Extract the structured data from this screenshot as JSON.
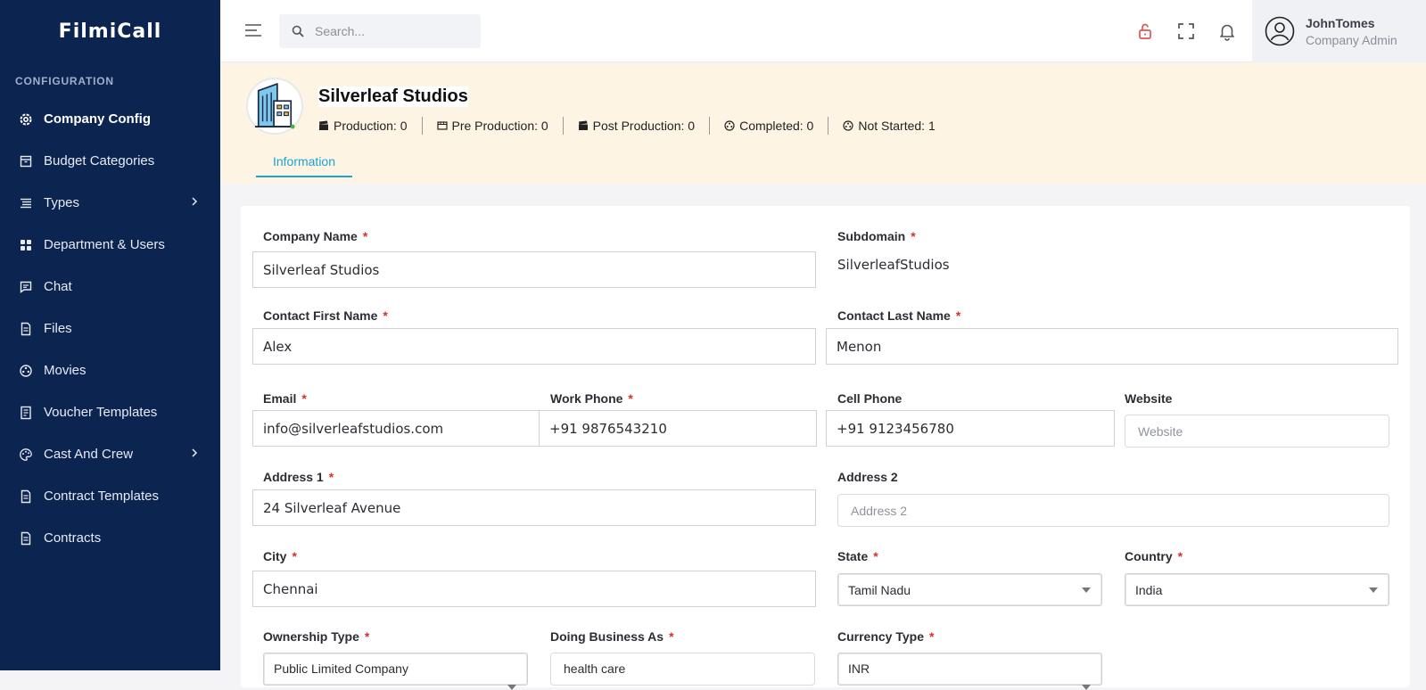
{
  "app": {
    "brand": "FilmiCall"
  },
  "sidebar": {
    "section_label": "CONFIGURATION",
    "items": [
      {
        "label": "Company Config",
        "icon": "gear-icon",
        "active": true
      },
      {
        "label": "Budget Categories",
        "icon": "archive-icon"
      },
      {
        "label": "Types",
        "icon": "list-icon",
        "has_children": true
      },
      {
        "label": "Department & Users",
        "icon": "grid-icon"
      },
      {
        "label": "Chat",
        "icon": "chat-icon"
      },
      {
        "label": "Files",
        "icon": "file-icon"
      },
      {
        "label": "Movies",
        "icon": "film-reel-icon"
      },
      {
        "label": "Voucher Templates",
        "icon": "document-icon"
      },
      {
        "label": "Cast And Crew",
        "icon": "palette-icon",
        "has_children": true
      },
      {
        "label": "Contract Templates",
        "icon": "document-icon"
      },
      {
        "label": "Contracts",
        "icon": "document-icon"
      }
    ]
  },
  "header": {
    "search_placeholder": "Search...",
    "user_name": "JohnTomes",
    "user_role": "Company Admin"
  },
  "company": {
    "name": "Silverleaf Studios",
    "stats": [
      {
        "label": "Production: 0",
        "icon": "clapper-icon"
      },
      {
        "label": "Pre Production: 0",
        "icon": "film-icon"
      },
      {
        "label": "Post Production: 0",
        "icon": "clapper-icon"
      },
      {
        "label": "Completed: 0",
        "icon": "film-reel-icon"
      },
      {
        "label": "Not Started: 1",
        "icon": "film-reel-icon"
      }
    ],
    "tab": "Information"
  },
  "form": {
    "company_name": {
      "label": "Company Name",
      "value": "Silverleaf Studios"
    },
    "subdomain": {
      "label": "Subdomain",
      "value": "SilverleafStudios"
    },
    "contact_first": {
      "label": "Contact First Name",
      "value": "Alex"
    },
    "contact_last": {
      "label": "Contact Last Name",
      "value": "Menon"
    },
    "email": {
      "label": "Email",
      "value": "info@silverleafstudios.com"
    },
    "work_phone": {
      "label": "Work Phone",
      "value": "+91 9876543210"
    },
    "cell_phone": {
      "label": "Cell Phone",
      "value": "+91 9123456780"
    },
    "website": {
      "label": "Website",
      "placeholder": "Website"
    },
    "address1": {
      "label": "Address 1",
      "value": "24 Silverleaf Avenue"
    },
    "address2": {
      "label": "Address 2",
      "placeholder": "Address 2"
    },
    "city": {
      "label": "City",
      "value": "Chennai"
    },
    "state": {
      "label": "State",
      "value": "Tamil Nadu"
    },
    "country": {
      "label": "Country",
      "value": "India"
    },
    "ownership": {
      "label": "Ownership Type",
      "value": "Public Limited Company"
    },
    "dba": {
      "label": "Doing Business As",
      "value": "health care"
    },
    "currency": {
      "label": "Currency Type",
      "value": "INR"
    },
    "required_mark": "*"
  },
  "colors": {
    "sidebar": "#0c2450",
    "accent": "#1aa3d4",
    "banner": "#fdf4e3",
    "required": "#d9302c",
    "lock": "#e05555"
  }
}
